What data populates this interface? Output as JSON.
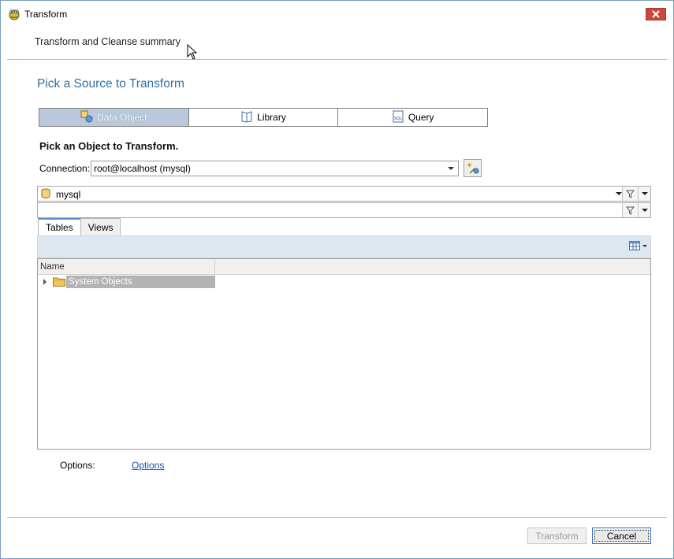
{
  "window": {
    "title": "Transform"
  },
  "header": {
    "summary": "Transform and Cleanse summary"
  },
  "main": {
    "heading": "Pick a Source to Transform",
    "source_tabs": [
      {
        "label": "Data Object"
      },
      {
        "label": "Library"
      },
      {
        "label": "Query"
      }
    ],
    "pick_label": "Pick an Object to Transform.",
    "connection": {
      "label": "Connection:",
      "value": "root@localhost (mysql)"
    },
    "database": {
      "value": "mysql"
    },
    "filter": {
      "value": ""
    },
    "object_tabs": [
      {
        "label": "Tables"
      },
      {
        "label": "Views"
      }
    ],
    "table": {
      "columns": [
        "Name"
      ],
      "rows": [
        {
          "label": "System Objects"
        }
      ]
    },
    "options": {
      "label": "Options:",
      "link": "Options"
    }
  },
  "footer": {
    "transform_label": "Transform",
    "cancel_label": "Cancel"
  },
  "colors": {
    "accent": "#2f73a8",
    "active_segment": "#b9c8da",
    "close_button": "#c74a3d",
    "link": "#1a4fb0"
  }
}
